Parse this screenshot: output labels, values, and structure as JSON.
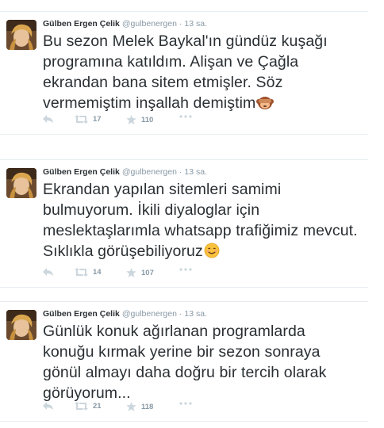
{
  "tweets": [
    {
      "name": "Gülben Ergen Çelik",
      "handle": "@gulbenergen",
      "separator": "·",
      "time": "13 sa.",
      "text": "Bu sezon Melek Baykal'ın gündüz kuşağı programına katıldım. Alişan ve Çağla ekrandan bana sitem etmişler. Söz vermemiştim inşallah demiştim",
      "emoji": "see-no-evil-monkey",
      "retweets": "17",
      "favorites": "110"
    },
    {
      "name": "Gülben Ergen Çelik",
      "handle": "@gulbenergen",
      "separator": "·",
      "time": "13 sa.",
      "text": "Ekrandan yapılan sitemleri samimi bulmuyorum. İkili diyaloglar için meslektaşlarımla whatsapp trafiğimiz mevcut. Sıklıkla görüşebiliyoruz",
      "emoji": "smiling-face",
      "retweets": "14",
      "favorites": "107"
    },
    {
      "name": "Gülben Ergen Çelik",
      "handle": "@gulbenergen",
      "separator": "·",
      "time": "13 sa.",
      "text": "Günlük konuk ağırlanan programlarda konuğu kırmak yerine bir sezon sonraya gönül almayı daha doğru bir tercih olarak görüyorum...",
      "emoji": "",
      "retweets": "21",
      "favorites": "118"
    }
  ],
  "icons": {
    "reply": "reply-icon",
    "retweet": "retweet-icon",
    "favorite": "star-icon",
    "more": "more-icon"
  },
  "colors": {
    "text": "#292f33",
    "muted": "#8899a6",
    "icon": "#ccd6dd",
    "border": "#e8edf1"
  }
}
